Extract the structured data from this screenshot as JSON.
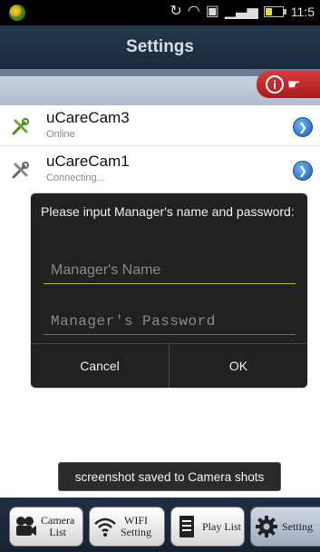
{
  "status_bar": {
    "time": "11:5"
  },
  "header": {
    "title": "Settings"
  },
  "devices": [
    {
      "name": "uCareCam3",
      "status": "Online"
    },
    {
      "name": "uCareCam1",
      "status": "Connecting..."
    }
  ],
  "dialog": {
    "message": "Please input Manager's name and password:",
    "name_placeholder": "Manager's Name",
    "password_placeholder": "Manager's Password",
    "cancel_label": "Cancel",
    "ok_label": "OK"
  },
  "toast": {
    "text": "screenshot saved to Camera shots"
  },
  "tabs": [
    {
      "line1": "Camera",
      "line2": "List"
    },
    {
      "line1": "WIFI",
      "line2": "Setting"
    },
    {
      "line1": "Play List",
      "line2": ""
    },
    {
      "line1": "Setting",
      "line2": ""
    }
  ],
  "colors": {
    "accent_green": "#96c22a",
    "header_bg": "#1b2a3d",
    "alert_red": "#c42a2a",
    "link_blue": "#1b5fb4"
  }
}
